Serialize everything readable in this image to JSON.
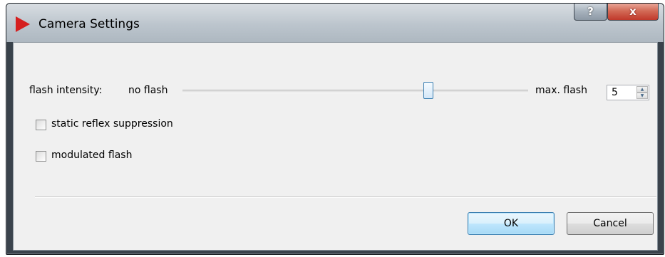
{
  "window": {
    "title": "Camera Settings",
    "help_label": "?",
    "close_label": "x"
  },
  "flash": {
    "label": "flash intensity:",
    "min_label": "no flash",
    "max_label": "max. flash",
    "slider_position": 0.71,
    "max_value": "5"
  },
  "options": {
    "static_reflex": {
      "label": "static reflex suppression",
      "checked": false
    },
    "modulated_flash": {
      "label": "modulated flash",
      "checked": false
    }
  },
  "buttons": {
    "ok": "OK",
    "cancel": "Cancel"
  },
  "colors": {
    "app_icon": "#d51f1f",
    "close_button": "#c0392b",
    "default_button_border": "#3c7fb1"
  }
}
